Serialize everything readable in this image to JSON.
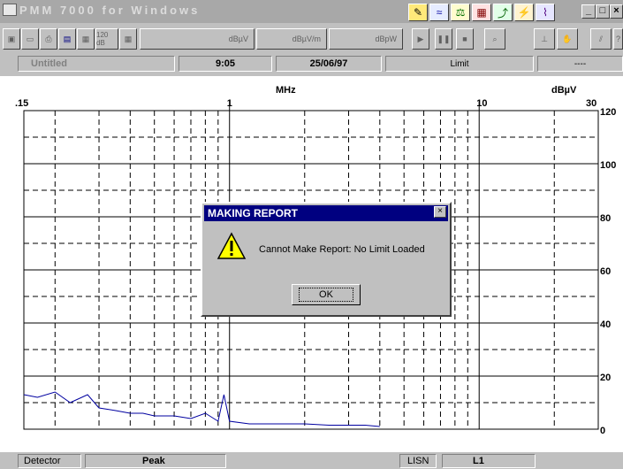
{
  "window": {
    "title": "PMM 7000 for Windows"
  },
  "toolbar": {
    "unit1": "dBµV",
    "unit2": "dBµV/m",
    "unit3": "dBpW",
    "badge": "120 dB"
  },
  "status": {
    "file": "Untitled",
    "time": "9:05",
    "date": "25/06/97",
    "limit_label": "Limit",
    "limit_value": "----"
  },
  "chart_axis": {
    "x_unit": "MHz",
    "y_unit": "dBµV",
    "x_ticks": [
      ".15",
      "1",
      "10",
      "30"
    ],
    "y_ticks": [
      "120",
      "100",
      "80",
      "60",
      "40",
      "20",
      "0"
    ]
  },
  "chart_data": {
    "type": "line",
    "xlabel": "MHz",
    "ylabel": "dBµV",
    "xscale": "log",
    "xlim": [
      0.15,
      30
    ],
    "ylim": [
      0,
      120
    ],
    "series": [
      {
        "x": [
          0.15,
          0.17,
          0.2,
          0.23,
          0.27,
          0.3,
          0.35,
          0.4,
          0.45,
          0.5,
          0.6,
          0.7,
          0.8,
          0.9,
          0.95,
          1.0,
          1.2,
          1.5,
          2.0,
          2.5,
          3.0,
          3.5,
          4.0
        ],
        "y": [
          13,
          12,
          14,
          10,
          13,
          8,
          7,
          6,
          6,
          5,
          5,
          4,
          6,
          3,
          13,
          3,
          2,
          2,
          2,
          1.5,
          1.5,
          1.5,
          1
        ]
      }
    ],
    "line_color": "#0000a0"
  },
  "dialog": {
    "title": "MAKING REPORT",
    "message": "Cannot Make Report: No Limit Loaded",
    "ok_label": "OK",
    "close_glyph": "×",
    "icon": "warning-icon"
  },
  "bottom": {
    "detector_label": "Detector",
    "detector_value": "Peak",
    "lisn_label": "LISN",
    "lisn_value": "L1"
  }
}
